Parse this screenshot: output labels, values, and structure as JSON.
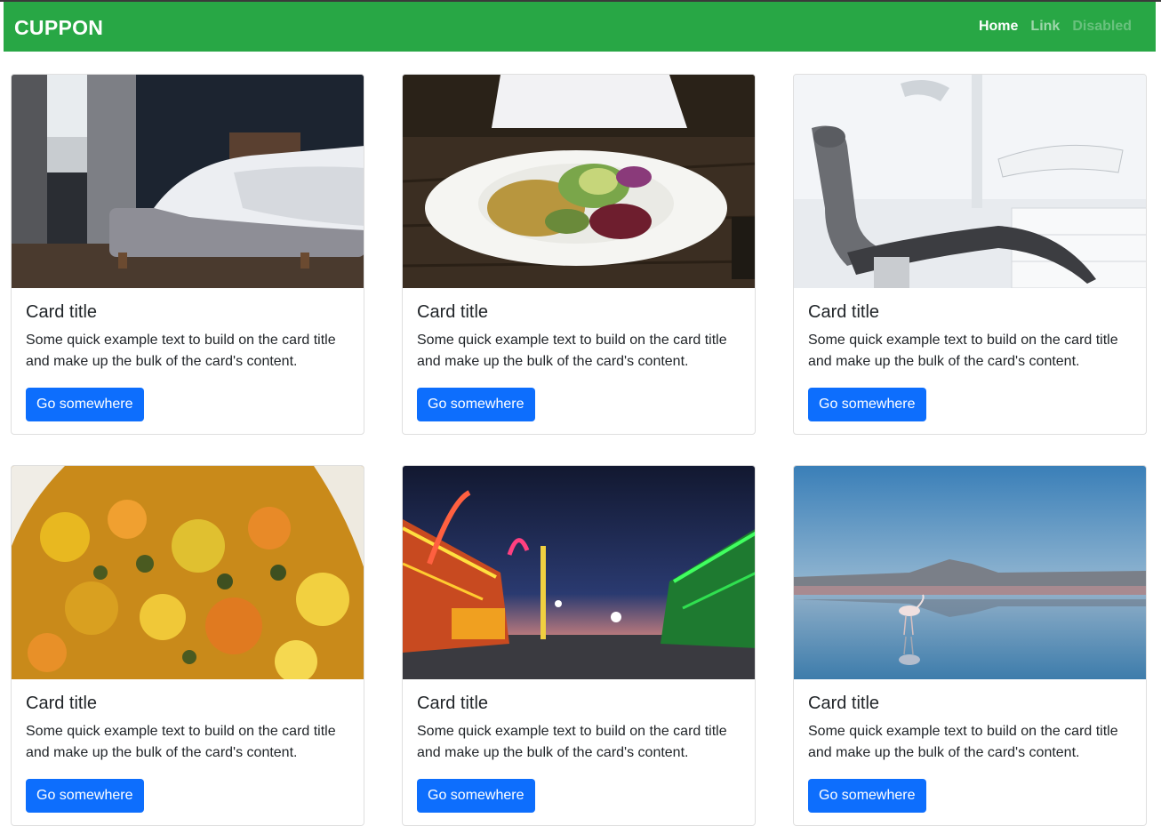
{
  "navbar": {
    "brand": "CUPPON",
    "links": [
      {
        "label": "Home",
        "state": "active"
      },
      {
        "label": "Link",
        "state": "normal"
      },
      {
        "label": "Disabled",
        "state": "disabled"
      }
    ],
    "background": "#28a745"
  },
  "cards": [
    {
      "title": "Card title",
      "text": "Some quick example text to build on the card title and make up the bulk of the card's content.",
      "button": "Go somewhere",
      "image": "bedroom-photo"
    },
    {
      "title": "Card title",
      "text": "Some quick example text to build on the card title and make up the bulk of the card's content.",
      "button": "Go somewhere",
      "image": "salad-bowl-photo"
    },
    {
      "title": "Card title",
      "text": "Some quick example text to build on the card title and make up the bulk of the card's content.",
      "button": "Go somewhere",
      "image": "dental-chair-photo"
    },
    {
      "title": "Card title",
      "text": "Some quick example text to build on the card title and make up the bulk of the card's content.",
      "button": "Go somewhere",
      "image": "vegetable-dish-photo"
    },
    {
      "title": "Card title",
      "text": "Some quick example text to build on the card title and make up the bulk of the card's content.",
      "button": "Go somewhere",
      "image": "carnival-night-photo"
    },
    {
      "title": "Card title",
      "text": "Some quick example text to build on the card title and make up the bulk of the card's content.",
      "button": "Go somewhere",
      "image": "flamingo-lake-photo"
    }
  ],
  "colors": {
    "button": "#0d6efd",
    "card_border": "#dfdfdf"
  }
}
